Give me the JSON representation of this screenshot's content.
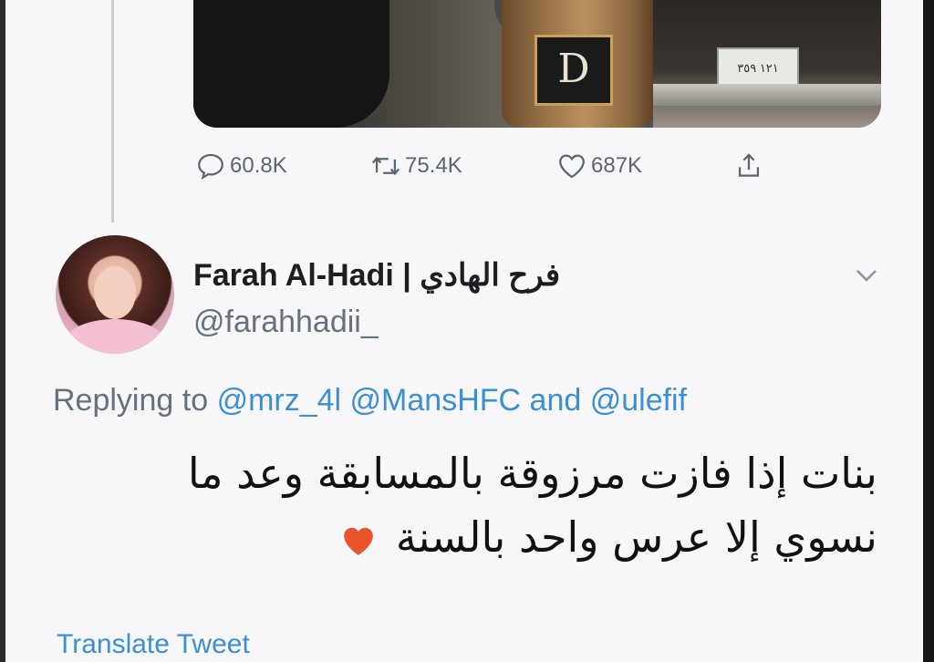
{
  "stats": {
    "replies": "60.8K",
    "retweets": "75.4K",
    "likes": "687K"
  },
  "media": {
    "cup_logo": "D",
    "plate_text": "١٢١ ٣٥٩"
  },
  "reply_tweet": {
    "display_name": "Farah Al-Hadi | فرح الهادي",
    "handle": "@farahhadii_",
    "replying_prefix": "Replying to",
    "mention_1": "@mrz_4l",
    "mention_2": "@MansHFC",
    "and_word": "and",
    "mention_3": "@ulefif",
    "text_line_1": "بنات إذا فازت مرزوقة بالمسابقة وعد ما",
    "text_line_2": "نسوي إلا عرس واحد بالسنة",
    "translate_label": "Translate Tweet"
  },
  "icons": [
    "reply-icon",
    "retweet-icon",
    "like-icon",
    "share-icon",
    "chevron-down-icon",
    "orange-heart-emoji"
  ],
  "colors": {
    "accent": "#3b8fd4",
    "secondary_text": "#65717b",
    "icon": "#5b6670",
    "heart_emoji": "#e8532a"
  }
}
